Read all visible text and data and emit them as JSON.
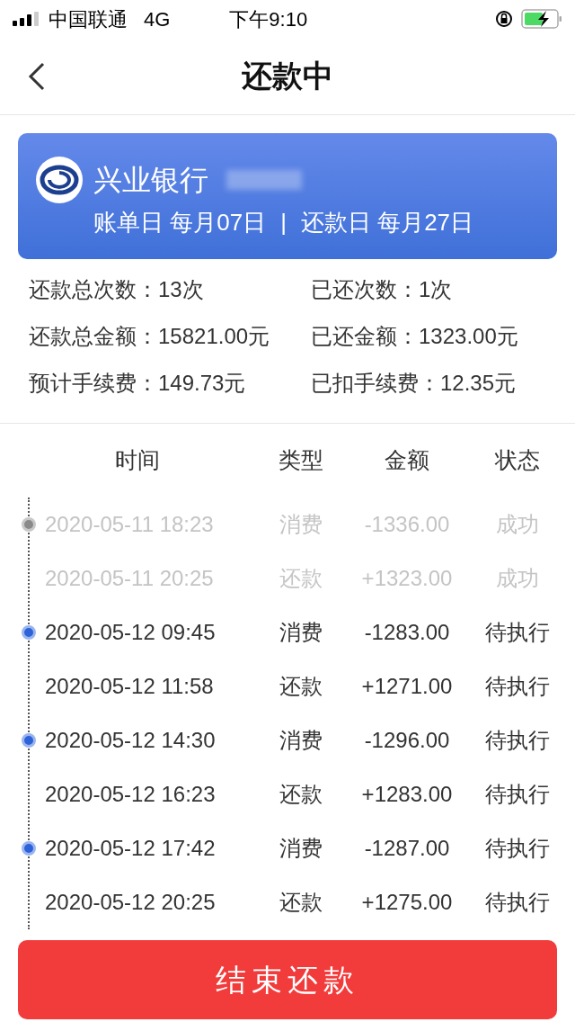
{
  "status_bar": {
    "carrier": "中国联通",
    "network": "4G",
    "time": "下午9:10"
  },
  "nav": {
    "title": "还款中"
  },
  "card": {
    "bank": "兴业银行",
    "bill_day": "账单日 每月07日",
    "separator": "|",
    "repay_day": "还款日 每月27日"
  },
  "stats": [
    {
      "label": "还款总次数：",
      "value": "13次"
    },
    {
      "label": "已还次数：",
      "value": "1次"
    },
    {
      "label": "还款总金额：",
      "value": "15821.00元"
    },
    {
      "label": "已还金额：",
      "value": "1323.00元"
    },
    {
      "label": "预计手续费：",
      "value": "149.73元"
    },
    {
      "label": "已扣手续费：",
      "value": "12.35元"
    }
  ],
  "table": {
    "columns": [
      "时间",
      "类型",
      "金额",
      "状态"
    ],
    "rows": [
      {
        "time": "2020-05-11 18:23",
        "type": "消费",
        "amount": "-1336.00",
        "status": "成功",
        "done": true,
        "dot": true
      },
      {
        "time": "2020-05-11 20:25",
        "type": "还款",
        "amount": "+1323.00",
        "status": "成功",
        "done": true,
        "dot": false
      },
      {
        "time": "2020-05-12 09:45",
        "type": "消费",
        "amount": "-1283.00",
        "status": "待执行",
        "done": false,
        "dot": true
      },
      {
        "time": "2020-05-12 11:58",
        "type": "还款",
        "amount": "+1271.00",
        "status": "待执行",
        "done": false,
        "dot": false
      },
      {
        "time": "2020-05-12 14:30",
        "type": "消费",
        "amount": "-1296.00",
        "status": "待执行",
        "done": false,
        "dot": true
      },
      {
        "time": "2020-05-12 16:23",
        "type": "还款",
        "amount": "+1283.00",
        "status": "待执行",
        "done": false,
        "dot": false
      },
      {
        "time": "2020-05-12 17:42",
        "type": "消费",
        "amount": "-1287.00",
        "status": "待执行",
        "done": false,
        "dot": true
      },
      {
        "time": "2020-05-12 20:25",
        "type": "还款",
        "amount": "+1275.00",
        "status": "待执行",
        "done": false,
        "dot": false
      }
    ]
  },
  "end_button": "结束还款"
}
